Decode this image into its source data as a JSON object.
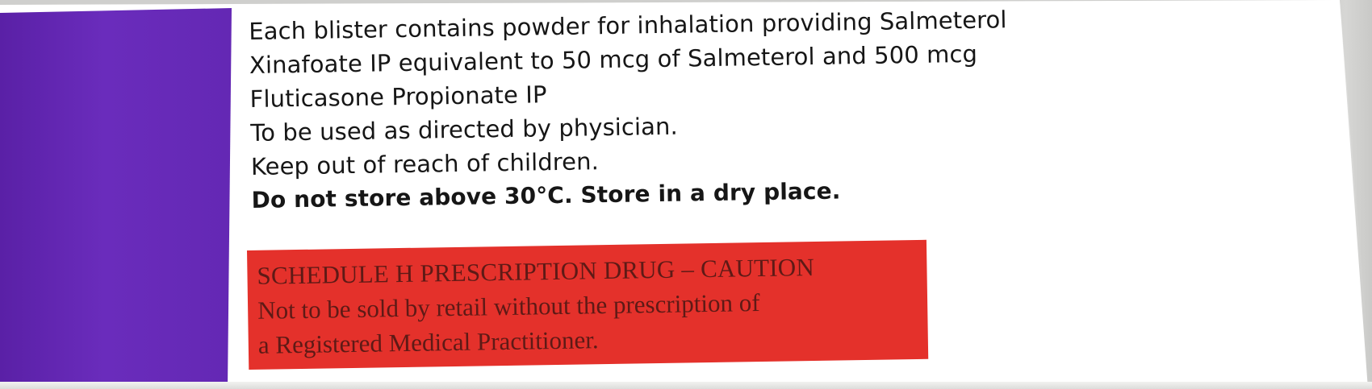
{
  "carton": {
    "colors": {
      "band": "#6428b4",
      "panel": "#ffffff",
      "caution_bg": "#e4312b",
      "caution_text": "#5e1a16",
      "body_text": "#161616"
    },
    "info_lines": [
      "Each blister contains powder for inhalation providing Salmeterol",
      "Xinafoate IP equivalent to 50 mcg of Salmeterol and 500 mcg",
      "Fluticasone Propionate IP",
      "To be used as directed by physician.",
      "Keep out of reach of children."
    ],
    "storage_line": "Do not store above 30°C. Store in a dry place.",
    "caution": {
      "title": "SCHEDULE H PRESCRIPTION DRUG – CAUTION",
      "line1": "Not to be sold by retail without the prescription of",
      "line2": "a Registered Medical Practitioner."
    }
  }
}
